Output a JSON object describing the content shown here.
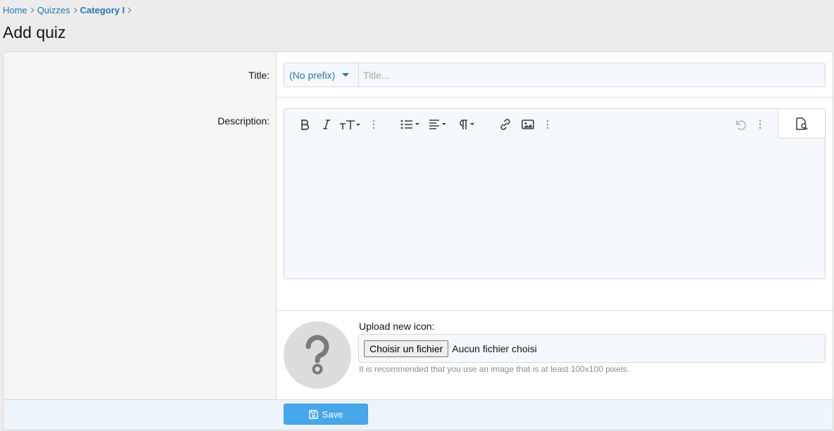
{
  "breadcrumb": {
    "items": [
      "Home",
      "Quizzes",
      "Category I"
    ]
  },
  "page": {
    "title": "Add quiz"
  },
  "form": {
    "title_label": "Title:",
    "prefix_value": "(No prefix)",
    "title_placeholder": "Title...",
    "title_value": "",
    "description_label": "Description:",
    "editor_icons": [
      "bold-icon",
      "italic-icon",
      "font-size-icon",
      "more-vertical-icon",
      "list-icon",
      "align-icon",
      "paragraph-icon",
      "link-icon",
      "image-icon",
      "more-vertical-icon",
      "undo-icon",
      "more-vertical-icon",
      "preview-icon"
    ],
    "upload_label": "Upload new icon:",
    "file_button": "Choisir un fichier",
    "file_status": "Aucun fichier choisi",
    "upload_hint": "It is recommended that you use an image that is at least 100x100 pixels.",
    "save_label": "Save"
  },
  "colors": {
    "link": "#2577b1",
    "button_primary": "#47a7eb",
    "input_bg": "#f5f9fd"
  }
}
